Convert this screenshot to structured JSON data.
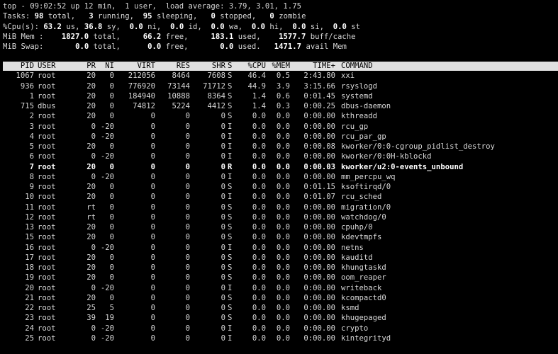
{
  "summary": {
    "top_line": {
      "prefix": "top - 09:02:52 up 12 min,  1 user,  load average: 3.79, 3.01, 1.75"
    },
    "tasks": {
      "label": "Tasks:",
      "total": "98",
      "total_label": " total,",
      "running": "3",
      "running_label": " running,",
      "sleeping": "95",
      "sleeping_label": " sleeping,",
      "stopped": "0",
      "stopped_label": " stopped,",
      "zombie": "0",
      "zombie_label": " zombie"
    },
    "cpu": {
      "label": "%Cpu(s):",
      "us": "63.2",
      "us_label": " us,",
      "sy": "36.8",
      "sy_label": " sy,",
      "ni": "0.0",
      "ni_label": " ni,",
      "id": "0.0",
      "id_label": " id,",
      "wa": "0.0",
      "wa_label": " wa,",
      "hi": "0.0",
      "hi_label": " hi,",
      "si": "0.0",
      "si_label": " si,",
      "st": "0.0",
      "st_label": " st"
    },
    "mem": {
      "label": "MiB Mem :",
      "total": "1827.0",
      "total_label": " total,",
      "free": "66.2",
      "free_label": " free,",
      "used": "183.1",
      "used_label": " used,",
      "buff": "1577.7",
      "buff_label": " buff/cache"
    },
    "swap": {
      "label": "MiB Swap:",
      "total": "0.0",
      "total_label": " total,",
      "free": "0.0",
      "free_label": " free,",
      "used": "0.0",
      "used_label": " used.",
      "avail": "1471.7",
      "avail_label": " avail Mem"
    }
  },
  "columns": [
    "PID",
    "USER",
    "PR",
    "NI",
    "VIRT",
    "RES",
    "SHR",
    "S",
    "%CPU",
    "%MEM",
    "TIME+",
    "COMMAND"
  ],
  "processes": [
    [
      "1067",
      "root",
      "20",
      "0",
      "212056",
      "8464",
      "7608",
      "S",
      "46.4",
      "0.5",
      "2:43.80",
      "xxi"
    ],
    [
      "936",
      "root",
      "20",
      "0",
      "776920",
      "73144",
      "71712",
      "S",
      "44.9",
      "3.9",
      "3:15.66",
      "rsyslogd"
    ],
    [
      "1",
      "root",
      "20",
      "0",
      "184940",
      "10888",
      "8364",
      "S",
      "1.4",
      "0.6",
      "0:01.45",
      "systemd"
    ],
    [
      "715",
      "dbus",
      "20",
      "0",
      "74812",
      "5224",
      "4412",
      "S",
      "1.4",
      "0.3",
      "0:00.25",
      "dbus-daemon"
    ],
    [
      "2",
      "root",
      "20",
      "0",
      "0",
      "0",
      "0",
      "S",
      "0.0",
      "0.0",
      "0:00.00",
      "kthreadd"
    ],
    [
      "3",
      "root",
      "0",
      "-20",
      "0",
      "0",
      "0",
      "I",
      "0.0",
      "0.0",
      "0:00.00",
      "rcu_gp"
    ],
    [
      "4",
      "root",
      "0",
      "-20",
      "0",
      "0",
      "0",
      "I",
      "0.0",
      "0.0",
      "0:00.00",
      "rcu_par_gp"
    ],
    [
      "5",
      "root",
      "20",
      "0",
      "0",
      "0",
      "0",
      "I",
      "0.0",
      "0.0",
      "0:00.08",
      "kworker/0:0-cgroup_pidlist_destroy"
    ],
    [
      "6",
      "root",
      "0",
      "-20",
      "0",
      "0",
      "0",
      "I",
      "0.0",
      "0.0",
      "0:00.00",
      "kworker/0:0H-kblockd"
    ],
    [
      "7",
      "root",
      "20",
      "0",
      "0",
      "0",
      "0",
      "R",
      "0.0",
      "0.0",
      "0:00.03",
      "kworker/u2:0-events_unbound"
    ],
    [
      "8",
      "root",
      "0",
      "-20",
      "0",
      "0",
      "0",
      "I",
      "0.0",
      "0.0",
      "0:00.00",
      "mm_percpu_wq"
    ],
    [
      "9",
      "root",
      "20",
      "0",
      "0",
      "0",
      "0",
      "S",
      "0.0",
      "0.0",
      "0:01.15",
      "ksoftirqd/0"
    ],
    [
      "10",
      "root",
      "20",
      "0",
      "0",
      "0",
      "0",
      "I",
      "0.0",
      "0.0",
      "0:01.07",
      "rcu_sched"
    ],
    [
      "11",
      "root",
      "rt",
      "0",
      "0",
      "0",
      "0",
      "S",
      "0.0",
      "0.0",
      "0:00.00",
      "migration/0"
    ],
    [
      "12",
      "root",
      "rt",
      "0",
      "0",
      "0",
      "0",
      "S",
      "0.0",
      "0.0",
      "0:00.00",
      "watchdog/0"
    ],
    [
      "13",
      "root",
      "20",
      "0",
      "0",
      "0",
      "0",
      "S",
      "0.0",
      "0.0",
      "0:00.00",
      "cpuhp/0"
    ],
    [
      "15",
      "root",
      "20",
      "0",
      "0",
      "0",
      "0",
      "S",
      "0.0",
      "0.0",
      "0:00.00",
      "kdevtmpfs"
    ],
    [
      "16",
      "root",
      "0",
      "-20",
      "0",
      "0",
      "0",
      "I",
      "0.0",
      "0.0",
      "0:00.00",
      "netns"
    ],
    [
      "17",
      "root",
      "20",
      "0",
      "0",
      "0",
      "0",
      "S",
      "0.0",
      "0.0",
      "0:00.00",
      "kauditd"
    ],
    [
      "18",
      "root",
      "20",
      "0",
      "0",
      "0",
      "0",
      "S",
      "0.0",
      "0.0",
      "0:00.00",
      "khungtaskd"
    ],
    [
      "19",
      "root",
      "20",
      "0",
      "0",
      "0",
      "0",
      "S",
      "0.0",
      "0.0",
      "0:00.00",
      "oom_reaper"
    ],
    [
      "20",
      "root",
      "0",
      "-20",
      "0",
      "0",
      "0",
      "I",
      "0.0",
      "0.0",
      "0:00.00",
      "writeback"
    ],
    [
      "21",
      "root",
      "20",
      "0",
      "0",
      "0",
      "0",
      "S",
      "0.0",
      "0.0",
      "0:00.00",
      "kcompactd0"
    ],
    [
      "22",
      "root",
      "25",
      "5",
      "0",
      "0",
      "0",
      "S",
      "0.0",
      "0.0",
      "0:00.00",
      "ksmd"
    ],
    [
      "23",
      "root",
      "39",
      "19",
      "0",
      "0",
      "0",
      "S",
      "0.0",
      "0.0",
      "0:00.00",
      "khugepaged"
    ],
    [
      "24",
      "root",
      "0",
      "-20",
      "0",
      "0",
      "0",
      "I",
      "0.0",
      "0.0",
      "0:00.00",
      "crypto"
    ],
    [
      "25",
      "root",
      "0",
      "-20",
      "0",
      "0",
      "0",
      "I",
      "0.0",
      "0.0",
      "0:00.00",
      "kintegrityd"
    ]
  ],
  "highlight_pid": "7",
  "colors": {
    "background": "#000000",
    "text": "#d8d8d8",
    "bold_text": "#ffffff",
    "header_bg": "#e0e0e0",
    "header_fg": "#000000"
  }
}
